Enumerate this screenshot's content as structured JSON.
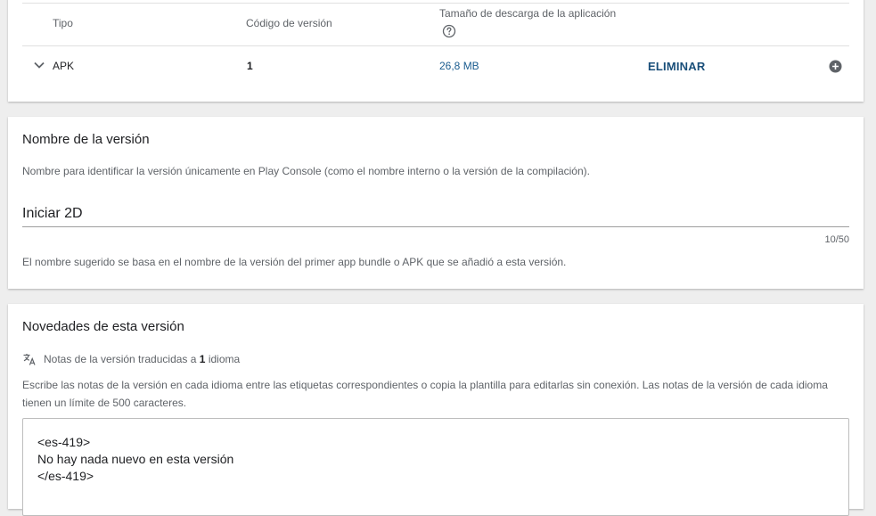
{
  "table": {
    "headers": {
      "type": "Tipo",
      "version_code": "Código de versión",
      "download_size": "Tamaño de descarga de la aplicación"
    },
    "row": {
      "type": "APK",
      "version_code": "1",
      "download_size": "26,8 MB",
      "remove_label": "ELIMINAR"
    }
  },
  "version_name": {
    "title": "Nombre de la versión",
    "description": "Nombre para identificar la versión únicamente en Play Console (como el nombre interno o la versión de la compilación).",
    "value": "Iniciar 2D",
    "counter": "10/50",
    "hint": "El nombre sugerido se basa en el nombre de la versión del primer app bundle o APK que se añadió a esta versión."
  },
  "release_notes": {
    "title": "Novedades de esta versión",
    "translated_prefix": "Notas de la versión traducidas a",
    "translated_count": "1",
    "translated_suffix": "idioma",
    "description": "Escribe las notas de la versión en cada idioma entre las etiquetas correspondientes o copia la plantilla para editarlas sin conexión. Las notas de la versión de cada idioma tienen un límite de 500 caracteres.",
    "text": "<es-419>\nNo hay nada nuevo en esta versión\n</es-419>"
  },
  "colors": {
    "accent": "#1a4f7a",
    "link": "#1a5c8f",
    "background": "#eeeeee"
  },
  "icons": [
    "help-icon",
    "chevron-down-icon",
    "add-circle-icon",
    "translate-icon"
  ]
}
